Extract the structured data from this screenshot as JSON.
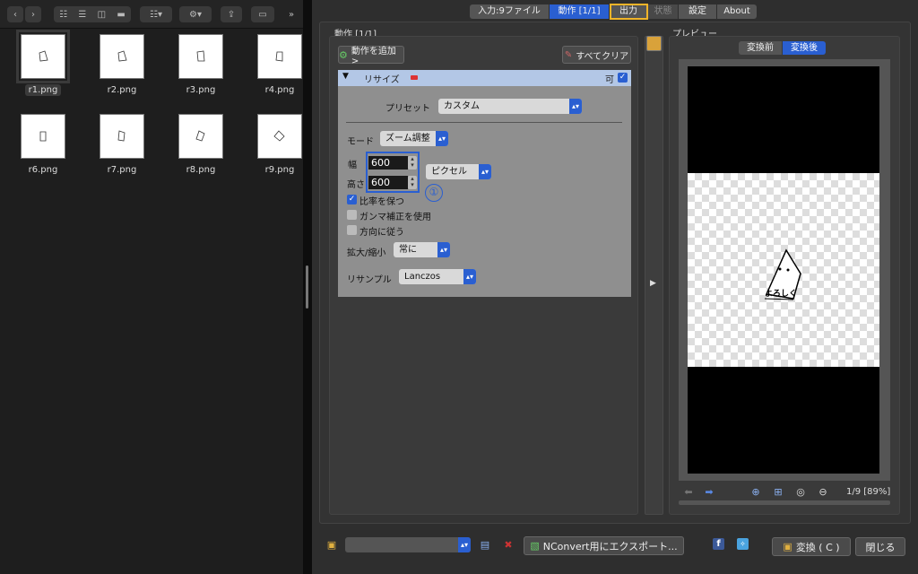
{
  "finder": {
    "files_row1": [
      "r1.png",
      "r2.png",
      "r3.png",
      "r4.png"
    ],
    "files_row2": [
      "r6.png",
      "r7.png",
      "r8.png",
      "r9.png"
    ]
  },
  "tabs": {
    "input": "入力:9ファイル",
    "actions": "動作 [1/1]",
    "output": "出力",
    "status": "状態",
    "settings": "設定",
    "about": "About"
  },
  "actions_panel": {
    "title": "動作 [1/1]",
    "add_action": "動作を追加>",
    "clear_all": "すべてクリア",
    "resize_header": "リサイズ",
    "enabled_label": "可",
    "preset_label": "プリセット",
    "preset_value": "カスタム",
    "mode_label": "モード",
    "mode_value": "ズーム調整",
    "width_label": "幅",
    "width_value": "600",
    "height_label": "高さ",
    "height_value": "600",
    "unit_value": "ピクセル",
    "keep_ratio": "比率を保つ",
    "gamma": "ガンマ補正を使用",
    "orientation": "方向に従う",
    "enlarge_label": "拡大/縮小",
    "enlarge_value": "常に",
    "resample_label": "リサンプル",
    "resample_value": "Lanczos"
  },
  "annotations": {
    "one": "①",
    "two": "②"
  },
  "preview": {
    "title": "プレビュー",
    "before": "変換前",
    "after": "変換後",
    "image_text": "よろしく",
    "page_info": "1/9 [89%]"
  },
  "footer": {
    "export": "NConvert用にエクスポート...",
    "convert": "変換 ( C )",
    "close": "閉じる"
  },
  "colors": {
    "accent": "#2a5fd1",
    "annotation": "#f0b429"
  }
}
